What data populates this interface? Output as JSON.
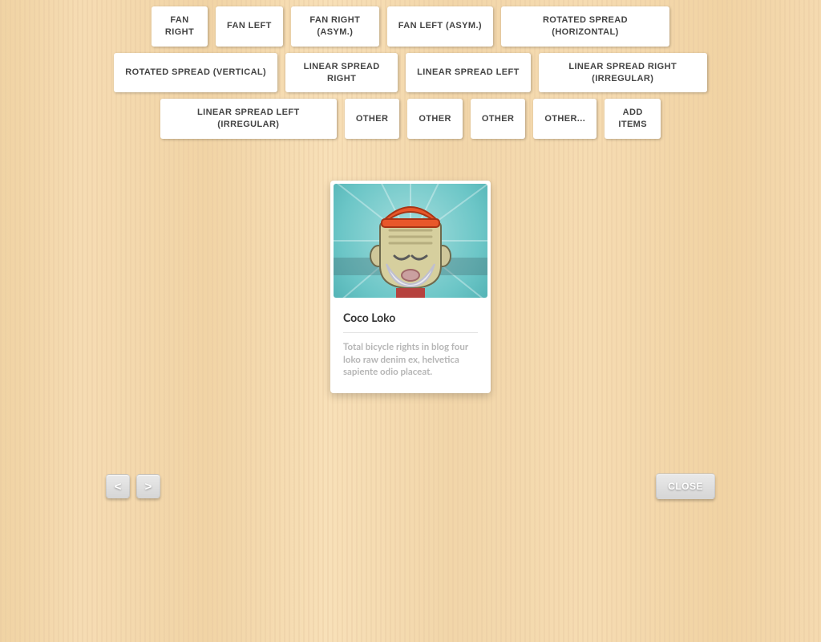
{
  "nav": {
    "buttons": [
      "FAN RIGHT",
      "FAN LEFT",
      "FAN RIGHT (ASYM.)",
      "FAN LEFT (ASYM.)",
      "ROTATED SPREAD (HORIZONTAL)",
      "ROTATED SPREAD (VERTICAL)",
      "LINEAR SPREAD RIGHT",
      "LINEAR SPREAD LEFT",
      "LINEAR SPREAD RIGHT (IRREGULAR)",
      "LINEAR SPREAD LEFT (IRREGULAR)",
      "OTHER",
      "OTHER",
      "OTHER",
      "OTHER...",
      "ADD ITEMS"
    ]
  },
  "card": {
    "title": "Coco Loko",
    "desc": "Total bicycle rights in blog four loko raw denim ex, helvetica sapiente odio placeat.",
    "image_alt": "illustrated bearded man with orange beanie on teal sunburst",
    "icon": "avatar-illustration"
  },
  "controls": {
    "prev": "<",
    "next": ">",
    "close": "CLOSE"
  },
  "colors": {
    "card_bg": "#ffffff",
    "text_muted": "#b6b6b6",
    "accent_orange": "#e8572a",
    "accent_teal": "#6cc6c7"
  }
}
